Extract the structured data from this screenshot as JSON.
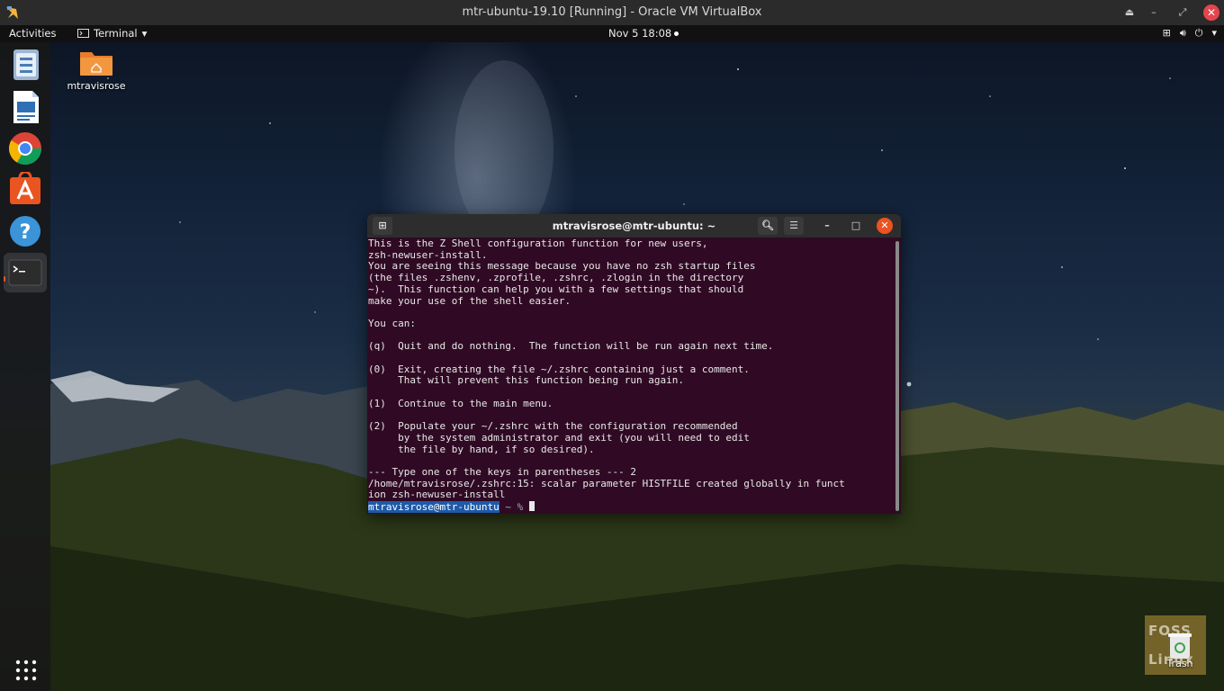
{
  "host_window": {
    "title": "mtr-ubuntu-19.10 [Running] - Oracle VM VirtualBox",
    "icons": [
      "virtualbox-icon",
      "minimize-icon",
      "restore-icon",
      "maximize-icon",
      "close-icon"
    ]
  },
  "topbar": {
    "activities": "Activities",
    "app_menu": "Terminal",
    "clock": "Nov 5  18:08",
    "tray_icons": [
      "network-icon",
      "volume-icon",
      "power-icon",
      "chevron-down-icon"
    ]
  },
  "dock": {
    "items": [
      "files-icon",
      "writer-icon",
      "chrome-icon",
      "software-icon",
      "help-icon",
      "terminal-icon"
    ],
    "apps_grid_icon": "show-apps-icon"
  },
  "desktop": {
    "home_folder_label": "mtravisrose",
    "trash_label": "Trash"
  },
  "terminal": {
    "title": "mtravisrose@mtr-ubuntu: ~",
    "output_lines": [
      "This is the Z Shell configuration function for new users,",
      "zsh-newuser-install.",
      "You are seeing this message because you have no zsh startup files",
      "(the files .zshenv, .zprofile, .zshrc, .zlogin in the directory",
      "~).  This function can help you with a few settings that should",
      "make your use of the shell easier.",
      "",
      "You can:",
      "",
      "(q)  Quit and do nothing.  The function will be run again next time.",
      "",
      "(0)  Exit, creating the file ~/.zshrc containing just a comment.",
      "     That will prevent this function being run again.",
      "",
      "(1)  Continue to the main menu.",
      "",
      "(2)  Populate your ~/.zshrc with the configuration recommended",
      "     by the system administrator and exit (you will need to edit",
      "     the file by hand, if so desired).",
      "",
      "--- Type one of the keys in parentheses --- 2",
      "/home/mtravisrose/.zshrc:15: scalar parameter HISTFILE created globally in funct",
      "ion zsh-newuser-install"
    ],
    "prompt_user": "mtravisrose@mtr-ubuntu",
    "prompt_tail": " ~ % "
  },
  "watermark": {
    "line1": "FOSS",
    "line2": "Linux"
  }
}
